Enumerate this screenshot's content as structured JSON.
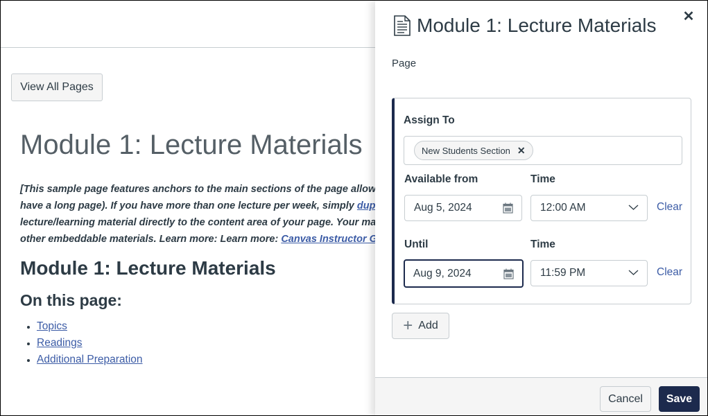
{
  "page": {
    "view_all_pages_label": "View All Pages",
    "title": "Module 1: Lecture Materials",
    "intro_lines": [
      {
        "text": "[This sample page features anchors to the main sections of the page allowing",
        "link": ""
      },
      {
        "text": "have a long page). If you have more than one lecture per week,  simply ",
        "link": "duplicate"
      },
      {
        "text": "lecture/learning material directly to the content area of your page. Your materials",
        "link": ""
      },
      {
        "text": "other embeddable materials. Learn more:  Learn more: ",
        "link": "Canvas Instructor Guide"
      }
    ],
    "heading": "Module 1: Lecture Materials",
    "subheading": "On this page:",
    "toc": [
      "Topics",
      "Readings",
      "Additional Preparation"
    ]
  },
  "tray": {
    "icon": "document-icon",
    "title": "Module 1: Lecture Materials",
    "subtitle": "Page",
    "close_icon": "close-icon",
    "assign_card": {
      "assign_to_label": "Assign To",
      "assignees": [
        "New Students Section"
      ],
      "available_from_label": "Available from",
      "available_from_date": "Aug 5, 2024",
      "available_from_time_label": "Time",
      "available_from_time": "12:00 AM",
      "until_label": "Until",
      "until_date": "Aug 9, 2024",
      "until_time_label": "Time",
      "until_time": "11:59 PM",
      "clear_label": "Clear"
    },
    "add_label": "Add",
    "cancel_label": "Cancel",
    "save_label": "Save"
  },
  "colors": {
    "brand_dark": "#1c2a4d",
    "link": "#3c5ca6",
    "text": "#2d3b45",
    "border": "#c7cdd1"
  }
}
